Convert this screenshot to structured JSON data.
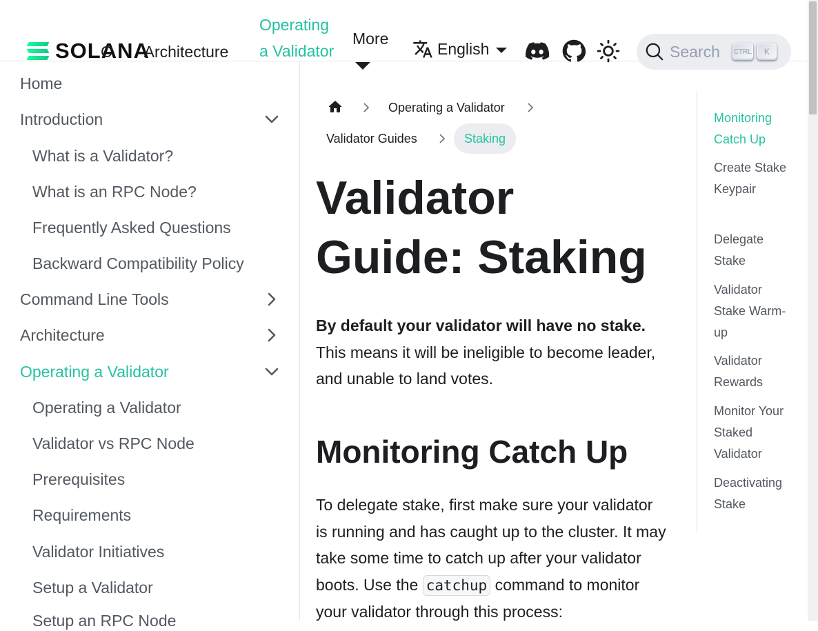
{
  "navbar": {
    "logo_text": "SOLANA",
    "overlap_link": "C",
    "architecture": "Architecture",
    "operating": "Operating a Validator",
    "more": "More",
    "language": "English",
    "search_placeholder": "Search",
    "kbd_ctrl": "CTRL",
    "kbd_k": "K",
    "accent_color": "#25c2a0"
  },
  "sidebar": {
    "items": [
      {
        "label": "Home"
      },
      {
        "label": "Introduction"
      },
      {
        "label": "What is a Validator?"
      },
      {
        "label": "What is an RPC Node?"
      },
      {
        "label": "Frequently Asked Questions"
      },
      {
        "label": "Backward Compatibility Policy"
      },
      {
        "label": "Command Line Tools"
      },
      {
        "label": "Architecture"
      },
      {
        "label": "Operating a Validator"
      },
      {
        "label": "Operating a Validator"
      },
      {
        "label": "Validator vs RPC Node"
      },
      {
        "label": "Prerequisites"
      },
      {
        "label": "Requirements"
      },
      {
        "label": "Validator Initiatives"
      },
      {
        "label": "Setup a Validator"
      },
      {
        "label": "Setup an RPC Node"
      }
    ]
  },
  "breadcrumbs": {
    "level1": "Operating a Validator",
    "level2": "Validator Guides",
    "current": "Staking"
  },
  "content": {
    "title": "Validator Guide: Staking",
    "intro_bold": "By default your validator will have no stake.",
    "intro_rest": " This means it will be ineligible to become leader, and unable to land votes.",
    "h2": "Monitoring Catch Up",
    "para2_a": "To delegate stake, first make sure your validator is running and has caught up to the cluster. It may take some time to catch up after your validator boots. Use the ",
    "para2_code": "catchup",
    "para2_b": " command to monitor your validator through this process:"
  },
  "toc": {
    "items": [
      {
        "label": "Monitoring Catch Up"
      },
      {
        "label": "Create Stake Keypair"
      },
      {
        "label": "Delegate Stake"
      },
      {
        "label": "Validator Stake Warm-up"
      },
      {
        "label": "Validator Rewards"
      },
      {
        "label": "Monitor Your Staked Validator"
      },
      {
        "label": "Deactivating Stake"
      }
    ]
  }
}
